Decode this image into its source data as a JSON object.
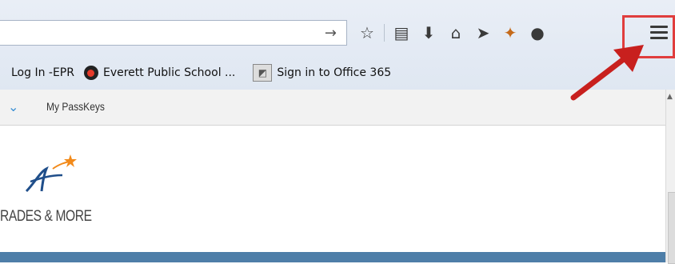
{
  "browser": {
    "url_value": "",
    "toolbar_icons": [
      "go-arrow-icon",
      "bookmark-star-icon",
      "reading-list-icon",
      "download-icon",
      "home-icon",
      "send-icon",
      "extension-icon",
      "chat-icon"
    ],
    "menu_button": "open-menu"
  },
  "bookmarks": {
    "items": [
      {
        "label": "Log In -EPR"
      },
      {
        "label": "Everett Public School ..."
      },
      {
        "label": "Sign in to Office 365"
      }
    ]
  },
  "site": {
    "subnav_label": "My PassKeys",
    "logo_text": "RADES & MORE"
  },
  "colors": {
    "highlight": "#e03d3d",
    "arrow": "#c8201e",
    "accent_blue": "#4e7ea8"
  }
}
